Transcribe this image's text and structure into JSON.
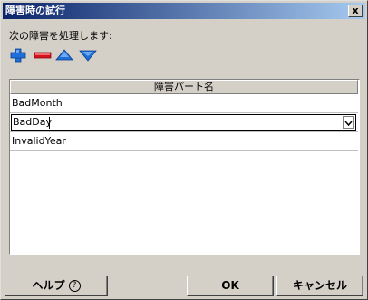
{
  "window": {
    "title": "障害時の試行",
    "close_glyph": "x"
  },
  "instruction": "次の障害を処理します:",
  "toolbar": {
    "add_icon": "plus-icon",
    "remove_icon": "minus-icon",
    "up_icon": "triangle-up-icon",
    "down_icon": "triangle-down-icon",
    "add_color": "#1e6fd9",
    "remove_color": "#d4141c"
  },
  "table": {
    "column_header": "障害パート名",
    "rows": [
      "BadMonth",
      "BadDay",
      "InvalidYear"
    ],
    "editing_row_index": 1
  },
  "buttons": {
    "help_label": "ヘルプ",
    "help_glyph": "?",
    "ok_label": "OK",
    "cancel_label": "キャンセル"
  }
}
